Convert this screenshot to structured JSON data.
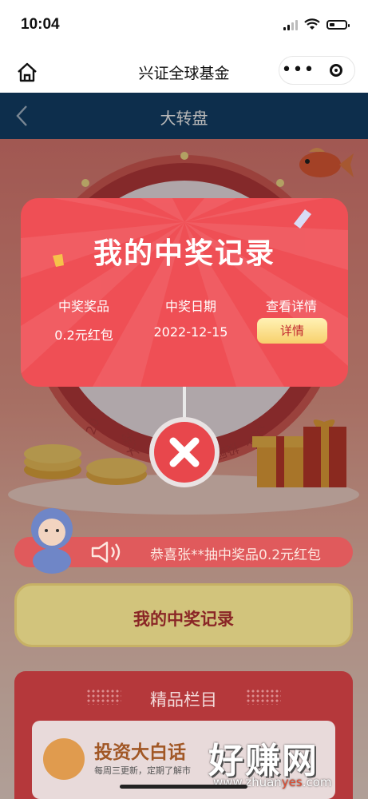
{
  "status": {
    "time": "10:04"
  },
  "mini_program": {
    "title": "兴证全球基金",
    "menu_dots": "•••"
  },
  "header": {
    "title": "大转盘"
  },
  "wheel": {
    "labels": [
      "20",
      "大奖",
      "兴证",
      "投顾"
    ]
  },
  "announcement": {
    "text": "恭喜张**抽中奖品0.2元红包"
  },
  "record_button": {
    "label": "我的中奖记录"
  },
  "featured": {
    "title": "精品栏目",
    "card": {
      "title": "投资大白话",
      "subtitle": "每周三更新，定期了解市"
    }
  },
  "modal": {
    "title": "我的中奖记录",
    "columns": [
      "中奖奖品",
      "中奖日期",
      "查看详情"
    ],
    "rows": [
      {
        "prize": "0.2元红包",
        "date": "2022-12-15",
        "action": "详情"
      }
    ]
  },
  "watermark": {
    "text": "好赚网",
    "url_prefix": "www.zhuan",
    "url_highlight": "yes",
    "url_suffix": ".com"
  },
  "colors": {
    "accent": "#ef4f55",
    "header_bg": "#13406a",
    "button_gold": "#f7d06c"
  },
  "icons": [
    "home-icon",
    "more-dots-icon",
    "target-icon",
    "back-arrow-icon",
    "speaker-icon",
    "close-icon"
  ]
}
